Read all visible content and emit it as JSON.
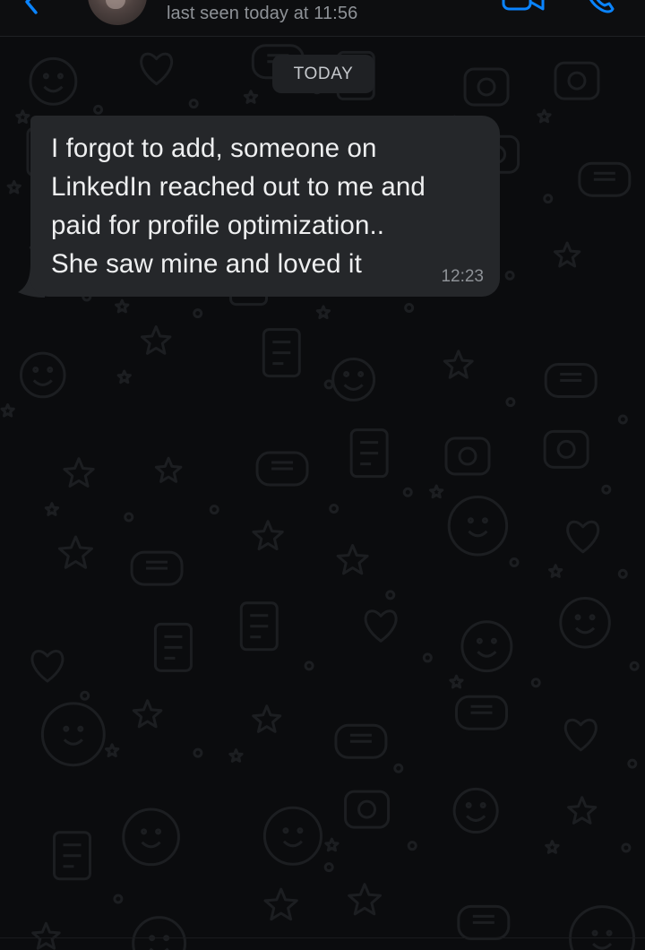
{
  "header": {
    "last_seen": "last seen today at 11:56",
    "icons": [
      "back-icon",
      "avatar",
      "video-call-icon",
      "voice-call-icon"
    ],
    "accent_color": "#0a84ff"
  },
  "chat": {
    "date_label": "TODAY",
    "messages": [
      {
        "direction": "incoming",
        "text": "I forgot to add, someone on\nLinkedIn reached out to me and\npaid for profile optimization..\nShe saw mine and loved it",
        "time": "12:23"
      }
    ]
  },
  "colors": {
    "background": "#0b0c0e",
    "bubble_incoming": "#25272a",
    "date_chip": "#1f2124",
    "secondary_text": "#8e9297"
  }
}
